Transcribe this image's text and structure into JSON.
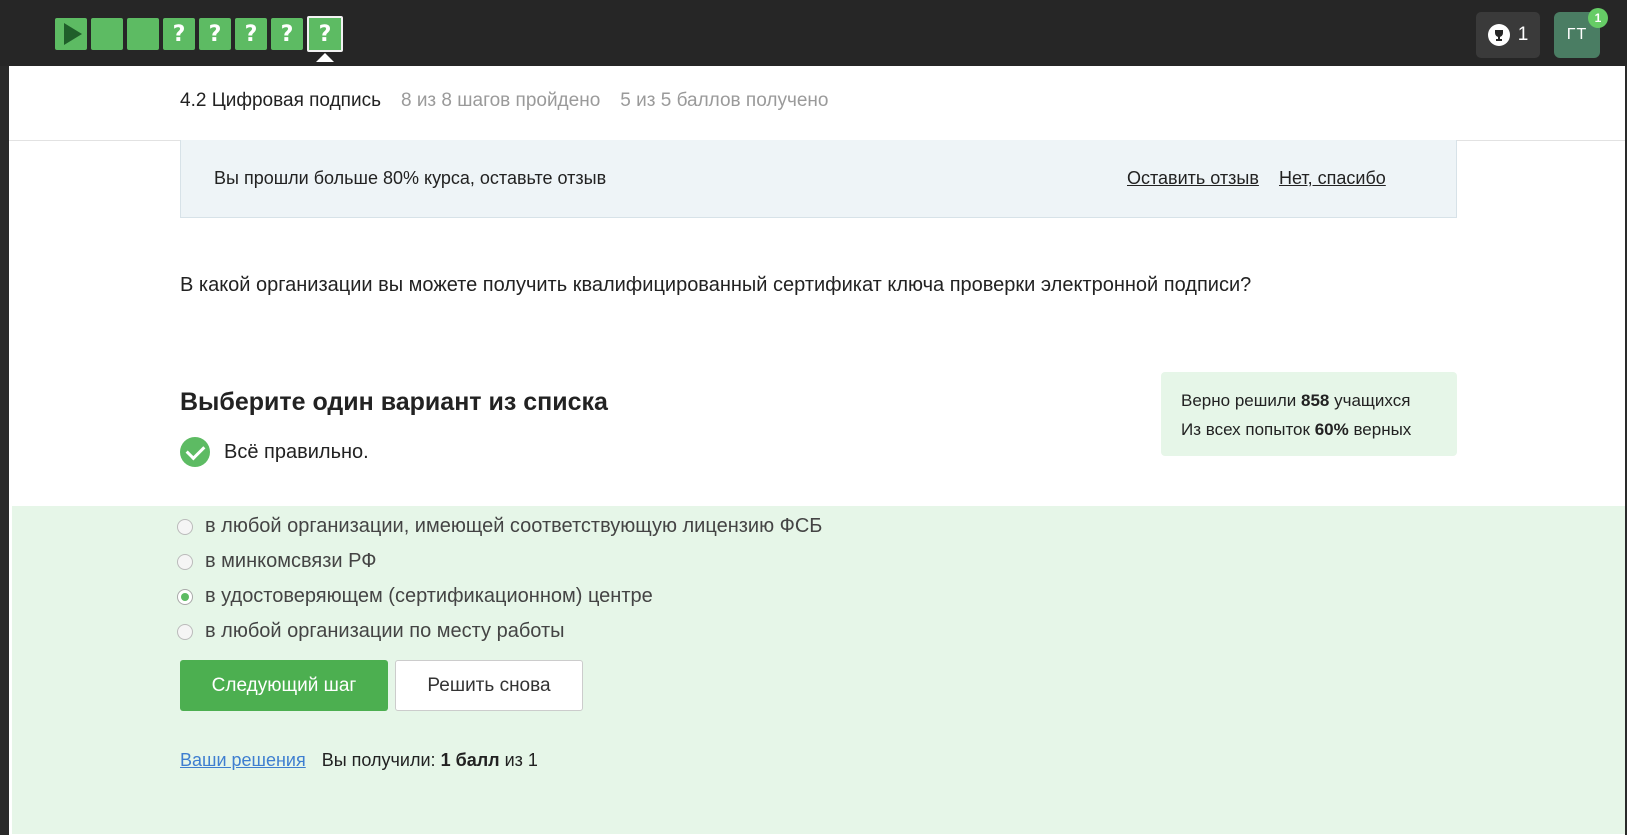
{
  "topbar": {
    "steps": [
      {
        "type": "play",
        "icon": "play-icon",
        "state": "done"
      },
      {
        "type": "blank",
        "label": "",
        "state": "done"
      },
      {
        "type": "blank",
        "label": "",
        "state": "done"
      },
      {
        "type": "quiz",
        "label": "?",
        "state": "done"
      },
      {
        "type": "quiz",
        "label": "?",
        "state": "done"
      },
      {
        "type": "quiz",
        "label": "?",
        "state": "done"
      },
      {
        "type": "quiz",
        "label": "?",
        "state": "done"
      },
      {
        "type": "quiz",
        "label": "?",
        "state": "current"
      }
    ],
    "trophy_count": "1",
    "avatar_initials": "ГТ",
    "notification_count": "1",
    "colors": {
      "step_green": "#5dbb63",
      "bar_bg": "#262626"
    }
  },
  "lesson": {
    "title": "4.2 Цифровая подпись",
    "progress": "8 из 8 шагов пройдено",
    "score": "5 из 5 баллов  получено"
  },
  "feedback_banner": {
    "text": "Вы прошли больше 80% курса, оставьте отзыв",
    "leave_review": "Оставить отзыв",
    "no_thanks": "Нет, спасибо"
  },
  "question": "В какой организации вы можете получить квалифицированный сертификат ключа проверки электронной подписи?",
  "choose_title": "Выберите один вариант из списка",
  "correct_text": "Всё правильно.",
  "stats": {
    "solved_prefix": "Верно решили",
    "solved_count": "858",
    "solved_suffix": "учащихся",
    "attempts_prefix": "Из всех попыток",
    "attempts_percent": "60%",
    "attempts_suffix": "верных"
  },
  "options": [
    {
      "label": "в любой организации, имеющей соответствующую лицензию ФСБ",
      "selected": false
    },
    {
      "label": "в минкомсвязи РФ",
      "selected": false
    },
    {
      "label": "в удостоверяющем (сертификационном) центре",
      "selected": true
    },
    {
      "label": "в любой организации по месту работы",
      "selected": false
    }
  ],
  "buttons": {
    "next": "Следующий шаг",
    "retry": "Решить снова"
  },
  "result": {
    "solutions_link": "Ваши решения",
    "received_prefix": "Вы получили:",
    "received_points": "1 балл",
    "received_suffix": "из 1"
  }
}
